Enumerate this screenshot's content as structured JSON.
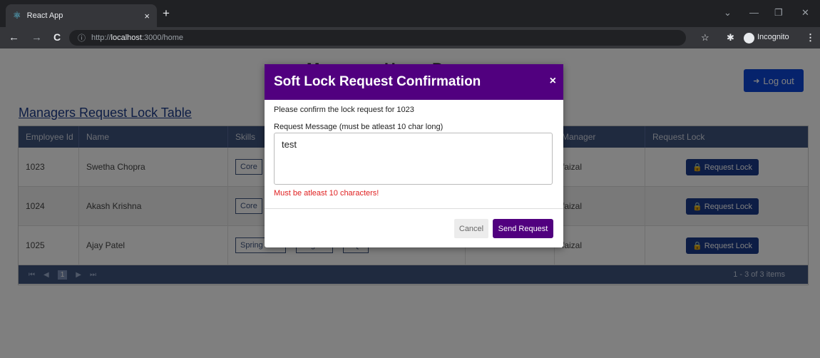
{
  "browser": {
    "tab_title": "React App",
    "tab_close": "×",
    "new_tab": "+",
    "url_scheme": "http://",
    "url_host": "localhost",
    "url_path": ":3000/home",
    "profile_label": "Incognito"
  },
  "header": {
    "page_heading": "Managers Home Page",
    "logout_label": "Log out"
  },
  "table": {
    "title": "Managers Request Lock Table",
    "columns": [
      "Employee Id",
      "Name",
      "Skills",
      "",
      "Manager",
      "Request Lock"
    ],
    "rows": [
      {
        "id": "1023",
        "name": "Swetha Chopra",
        "skills": [
          "Core"
        ],
        "manager": "faizal",
        "action": "Request Lock"
      },
      {
        "id": "1024",
        "name": "Akash Krishna",
        "skills": [
          "Core"
        ],
        "manager": "faizal",
        "action": "Request Lock"
      },
      {
        "id": "1025",
        "name": "Ajay Patel",
        "skills": [
          "Spring Boot",
          "Angular",
          "SQL"
        ],
        "manager": "faizal",
        "action": "Request Lock"
      }
    ],
    "pager": {
      "current_page": "1",
      "summary": "1 - 3 of 3 items"
    }
  },
  "modal": {
    "title": "Soft Lock Request Confirmation",
    "close": "×",
    "confirm_text": "Please confirm the lock request for 1023",
    "message_label": "Request Message (must be atleast 10 char long)",
    "message_value": "test",
    "error": "Must be atleast 10 characters!",
    "cancel_label": "Cancel",
    "send_label": "Send Request"
  },
  "colors": {
    "modal_header": "#51007f",
    "grid_header": "#3f547f",
    "logout_button": "#0d47d9",
    "error": "#e02020"
  }
}
